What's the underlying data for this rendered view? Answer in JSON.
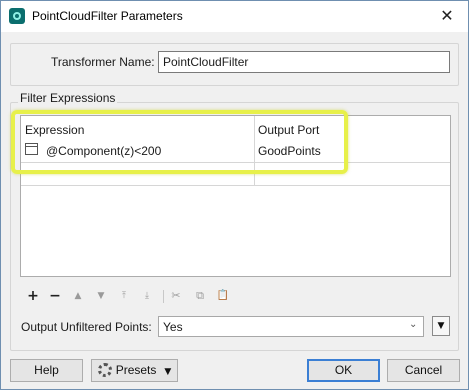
{
  "window": {
    "title": "PointCloudFilter Parameters",
    "close_glyph": "✕"
  },
  "transformer": {
    "label": "Transformer Name:",
    "value": "PointCloudFilter"
  },
  "filter_group": {
    "title": "Filter Expressions",
    "columns": [
      "Expression",
      "Output Port"
    ],
    "rows": [
      {
        "expression": "@Component(z)<200",
        "port": "GoodPoints"
      }
    ]
  },
  "toolbar": {
    "add": "+",
    "remove": "−",
    "move_up": "▲",
    "move_down": "▼",
    "move_top": "⤒",
    "move_bottom": "⤓",
    "cut": "✂",
    "copy": "⧉",
    "paste": "📋"
  },
  "unfiltered": {
    "label": "Output Unfiltered Points:",
    "value": "Yes",
    "arrow": "⌄",
    "menu_glyph": "▼"
  },
  "buttons": {
    "help": "Help",
    "presets": "Presets",
    "presets_caret": "▼",
    "ok": "OK",
    "cancel": "Cancel"
  },
  "colors": {
    "highlight": "#e7f04a",
    "ok_border": "#3b7fd4",
    "app_icon": "#0b6e6e"
  }
}
